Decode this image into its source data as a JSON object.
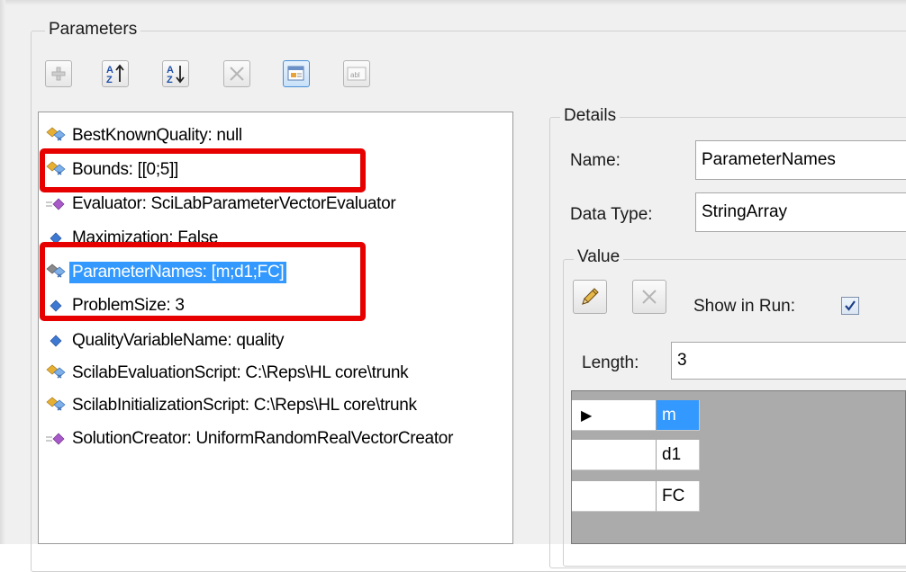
{
  "parameters": {
    "group_title": "Parameters",
    "toolbar": [
      {
        "name": "add-button",
        "icon": "plus-icon",
        "enabled": false
      },
      {
        "name": "sort-ascending-button",
        "icon": "sort-az-ascending-icon",
        "enabled": true
      },
      {
        "name": "sort-descending-button",
        "icon": "sort-az-descending-icon",
        "enabled": true
      },
      {
        "name": "remove-button",
        "icon": "x-icon",
        "enabled": false
      },
      {
        "name": "show-details-button",
        "icon": "properties-icon",
        "active": true
      },
      {
        "name": "rename-button",
        "icon": "text-field-icon",
        "enabled": false
      }
    ],
    "items": [
      {
        "label": "BestKnownQuality: null",
        "icon": "value-lookup-icon"
      },
      {
        "label": "Bounds: [[0;5]]",
        "icon": "value-lookup-icon"
      },
      {
        "label": "Evaluator: SciLabParameterVectorEvaluator",
        "icon": "operator-icon"
      },
      {
        "label": "Maximization: False",
        "icon": "value-icon"
      },
      {
        "label": "ParameterNames: [m;d1;FC]",
        "icon": "value-lookup-gray-icon",
        "selected": true
      },
      {
        "label": "ProblemSize: 3",
        "icon": "value-icon"
      },
      {
        "label": "QualityVariableName: quality",
        "icon": "value-icon"
      },
      {
        "label": "ScilabEvaluationScript: C:\\Reps\\HL core\\trunk",
        "icon": "value-lookup-icon"
      },
      {
        "label": "ScilabInitializationScript: C:\\Reps\\HL core\\trunk",
        "icon": "value-lookup-icon"
      },
      {
        "label": "SolutionCreator: UniformRandomRealVectorCreator",
        "icon": "operator-icon"
      }
    ]
  },
  "details": {
    "group_title": "Details",
    "name_label": "Name:",
    "name_value": "ParameterNames",
    "type_label": "Data Type:",
    "type_value": "StringArray",
    "value": {
      "group_title": "Value",
      "edit_icon": "pencil-icon",
      "clear_icon": "x-icon",
      "show_in_run_label": "Show in Run:",
      "show_in_run_checked": true,
      "length_label": "Length:",
      "length_value": "3",
      "rows": [
        "m",
        "d1",
        "FC"
      ],
      "current_row_marker": "▶"
    }
  },
  "colors": {
    "highlight": "#e60000",
    "selection": "#3399ff"
  }
}
